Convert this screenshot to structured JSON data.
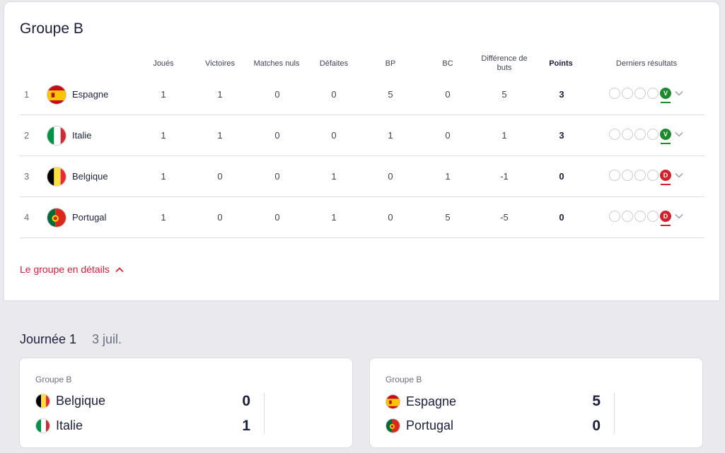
{
  "group": {
    "title": "Groupe B",
    "headers": {
      "played": "Joués",
      "wins": "Victoires",
      "draws": "Matches nuls",
      "losses": "Défaites",
      "gf": "BP",
      "ga": "BC",
      "diff": "Différence de buts",
      "points": "Points",
      "last": "Derniers résultats"
    },
    "rows": [
      {
        "rank": "1",
        "team": "Espagne",
        "played": "1",
        "wins": "1",
        "draws": "0",
        "losses": "0",
        "gf": "5",
        "ga": "0",
        "diff": "5",
        "points": "3",
        "last_result": "V",
        "last_type": "win",
        "flag": "spain-flag"
      },
      {
        "rank": "2",
        "team": "Italie",
        "played": "1",
        "wins": "1",
        "draws": "0",
        "losses": "0",
        "gf": "1",
        "ga": "0",
        "diff": "1",
        "points": "3",
        "last_result": "V",
        "last_type": "win",
        "flag": "italy-flag"
      },
      {
        "rank": "3",
        "team": "Belgique",
        "played": "1",
        "wins": "0",
        "draws": "0",
        "losses": "1",
        "gf": "0",
        "ga": "1",
        "diff": "-1",
        "points": "0",
        "last_result": "D",
        "last_type": "loss",
        "flag": "belgium-flag"
      },
      {
        "rank": "4",
        "team": "Portugal",
        "played": "1",
        "wins": "0",
        "draws": "0",
        "losses": "1",
        "gf": "0",
        "ga": "5",
        "diff": "-5",
        "points": "0",
        "last_result": "D",
        "last_type": "loss",
        "flag": "portugal-flag"
      }
    ],
    "details_link": "Le groupe en détails"
  },
  "matchday": {
    "title": "Journée 1",
    "date": "3 juil.",
    "matches": [
      {
        "group": "Groupe B",
        "home": "Belgique",
        "home_score": "0",
        "away": "Italie",
        "away_score": "1"
      },
      {
        "group": "Groupe B",
        "home": "Espagne",
        "home_score": "5",
        "away": "Portugal",
        "away_score": "0"
      }
    ]
  },
  "colors": {
    "win": "#1e8a2e",
    "loss": "#d4202c",
    "link": "#d4203d"
  }
}
